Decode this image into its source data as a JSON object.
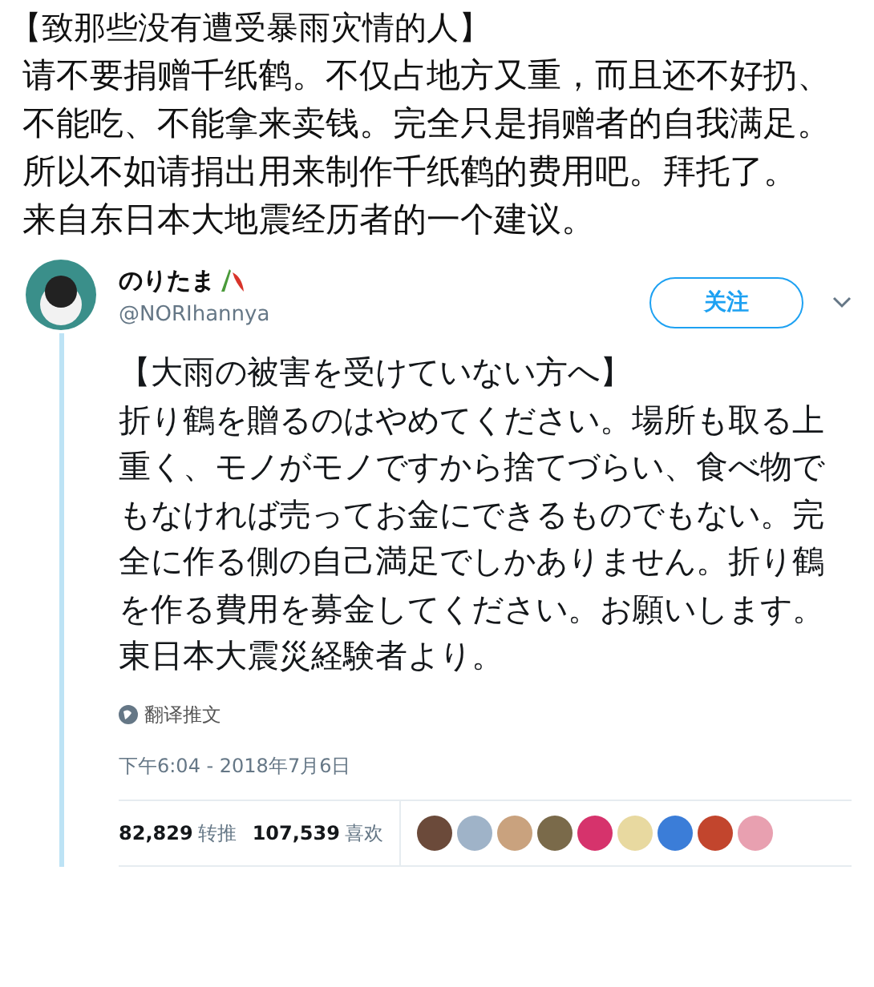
{
  "post": {
    "title": "【致那些没有遭受暴雨灾情的人】",
    "paragraphs": [
      "请不要捐赠千纸鹤。不仅占地方又重，而且还不好扔、不能吃、不能拿来卖钱。完全只是捐赠者的自我满足。所以不如请捐出用来制作千纸鹤的费用吧。拜托了。",
      "来自东日本大地震经历者的一个建议。"
    ]
  },
  "tweet": {
    "display_name": "のりたま",
    "handle": "@NORIhannya",
    "follow_button": "关注",
    "title": "【大雨の被害を受けていない方へ】",
    "body": "折り鶴を贈るのはやめてください。場所も取る上重く、モノがモノですから捨てづらい、食べ物でもなければ売ってお金にできるものでもない。完全に作る側の自己満足でしかありません。折り鶴を作る費用を募金してください。お願いします。東日本大震災経験者より。",
    "translate": "翻译推文",
    "timestamp": "下午6:04 - 2018年7月6日",
    "stats": [
      {
        "count": "82,829",
        "label": "转推"
      },
      {
        "count": "107,539",
        "label": "喜欢"
      }
    ]
  }
}
